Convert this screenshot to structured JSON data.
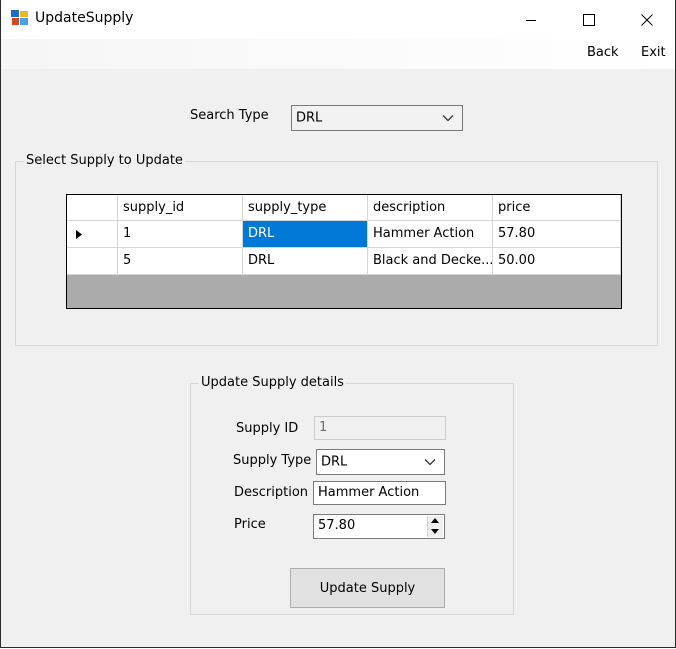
{
  "window": {
    "title": "UpdateSupply",
    "controls": {
      "minimize": "minimize",
      "maximize": "maximize",
      "close": "close"
    }
  },
  "menu": {
    "back_label": "Back",
    "exit_label": "Exit"
  },
  "search": {
    "label": "Search Type",
    "value": "DRL"
  },
  "select_group": {
    "title": "Select Supply to Update",
    "columns": [
      "supply_id",
      "supply_type",
      "description",
      "price"
    ],
    "rows": [
      {
        "supply_id": "1",
        "supply_type": "DRL",
        "description": "Hammer Action",
        "price": "57.80",
        "current": true
      },
      {
        "supply_id": "5",
        "supply_type": "DRL",
        "description": "Black and Decke...",
        "price": "50.00",
        "current": false
      }
    ]
  },
  "details": {
    "title": "Update Supply details",
    "supply_id_label": "Supply ID",
    "supply_id_value": "1",
    "supply_type_label": "Supply Type",
    "supply_type_value": "DRL",
    "description_label": "Description",
    "description_value": "Hammer Action",
    "price_label": "Price",
    "price_value": "57.80",
    "update_button_label": "Update Supply"
  },
  "colors": {
    "selection": "#0078d7",
    "form_bg": "#f0f0f0",
    "grid_bg": "#ababab"
  }
}
